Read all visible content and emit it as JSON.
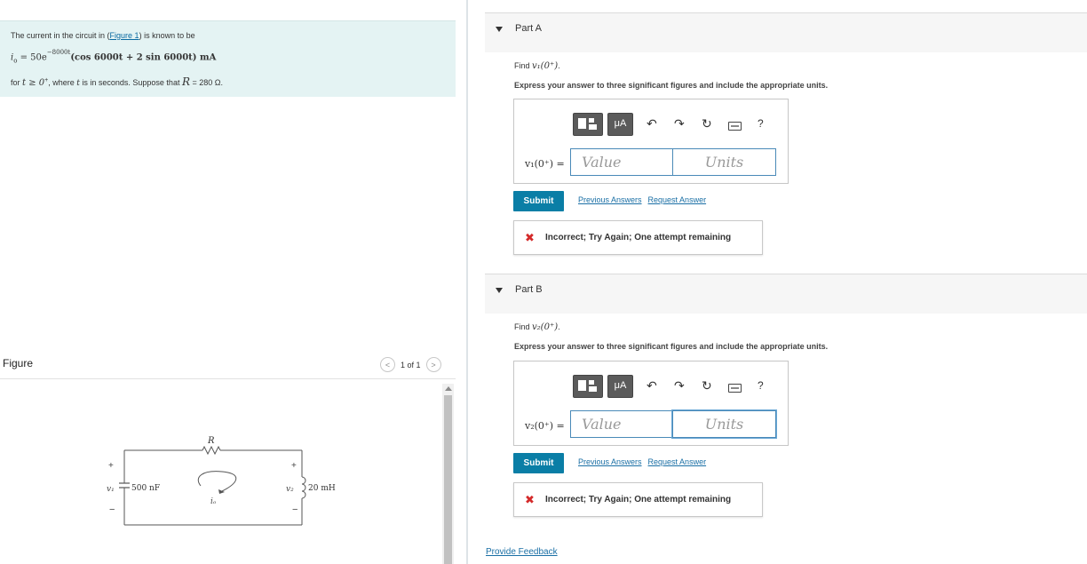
{
  "problem": {
    "intro_prefix": "The current in the circuit in (",
    "figure_link": "Figure 1",
    "intro_suffix": ") is known to be",
    "equation_lhs": "i",
    "equation_sub": "o",
    "equation_eq": " = 50e",
    "equation_exp": "−8000t",
    "equation_rest": "(cos 6000t + 2 sin 6000t) mA",
    "condition_prefix": "for ",
    "condition_math": "t ≥ 0",
    "condition_sup": "+",
    "condition_mid": ", where ",
    "condition_t": "t",
    "condition_suffix": " is in seconds. Suppose that ",
    "condition_r": "R",
    "condition_val": " = 280 Ω."
  },
  "figure": {
    "heading": "Figure",
    "pager_text": "1 of 1",
    "prev_glyph": "<",
    "next_glyph": ">",
    "circuit": {
      "r_label": "R",
      "c_value": "500 nF",
      "l_value": "20 mH",
      "v1_label": "v₁",
      "v2_label": "v₂",
      "i_label": "iₒ",
      "plus": "+",
      "minus": "−"
    }
  },
  "parts": [
    {
      "title": "Part A",
      "find_prefix": "Find ",
      "find_math": "v₁(0⁺)",
      "find_suffix": ".",
      "express": "Express your answer to three significant figures and include the appropriate units.",
      "var_label": "v₁(0⁺) =",
      "value_placeholder": "Value",
      "units_placeholder": "Units",
      "submit": "Submit",
      "prev_answers": "Previous Answers",
      "request_answer": "Request Answer",
      "feedback": "Incorrect; Try Again; One attempt remaining"
    },
    {
      "title": "Part B",
      "find_prefix": "Find ",
      "find_math": "v₂(0⁺)",
      "find_suffix": ".",
      "express": "Express your answer to three significant figures and include the appropriate units.",
      "var_label": "v₂(0⁺) =",
      "value_placeholder": "Value",
      "units_placeholder": "Units",
      "submit": "Submit",
      "prev_answers": "Previous Answers",
      "request_answer": "Request Answer",
      "feedback": "Incorrect; Try Again; One attempt remaining"
    }
  ],
  "toolbar": {
    "mu_label": "μA",
    "undo_glyph": "↶",
    "redo_glyph": "↷",
    "reset_glyph": "↻",
    "help_glyph": "?"
  },
  "provide_feedback": "Provide Feedback",
  "colors": {
    "problem_bg": "#e4f3f3",
    "submit_bg": "#0a7ea6",
    "link": "#1a6fa5",
    "error": "#d42a2a"
  }
}
